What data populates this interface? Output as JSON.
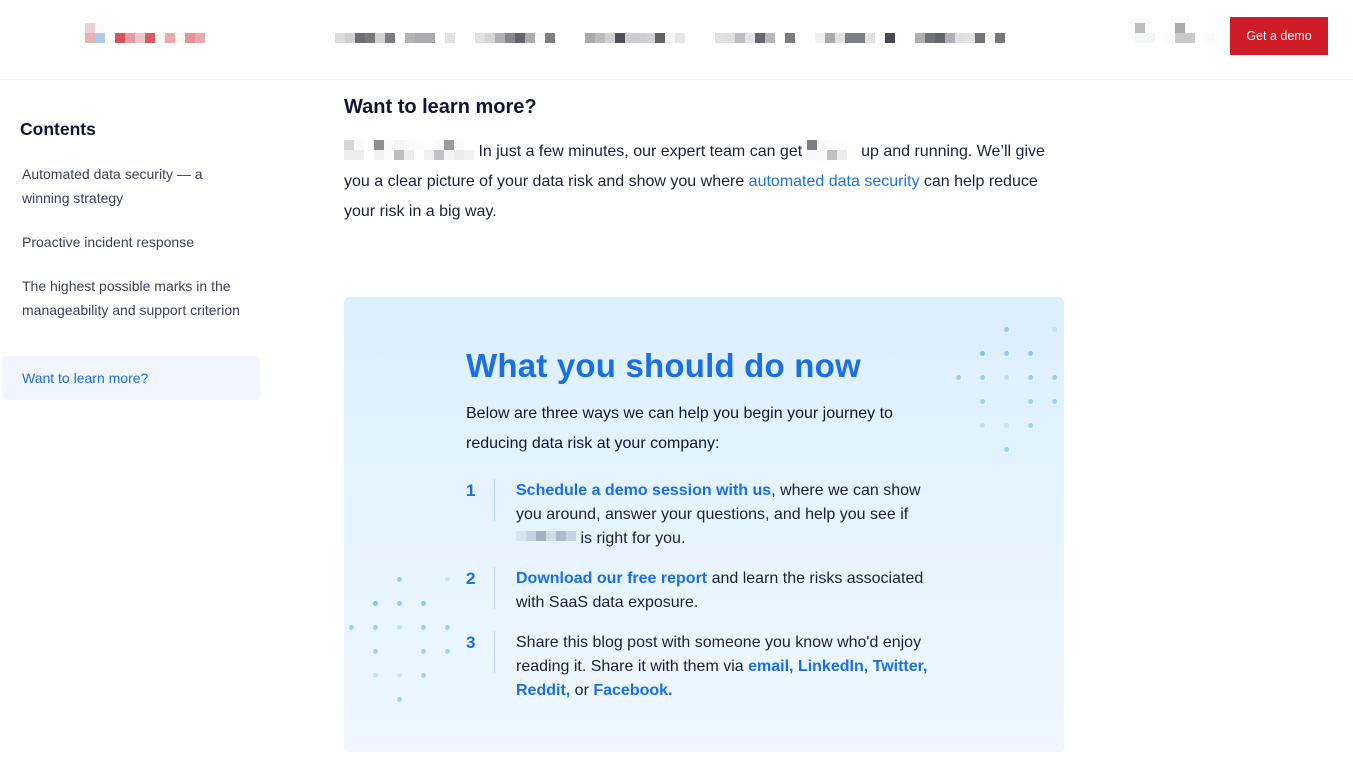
{
  "header": {
    "logo": "redacted-logo",
    "nav_items": [
      "redacted-nav-1",
      "redacted-nav-2",
      "redacted-nav-3",
      "redacted-nav-4",
      "redacted-nav-5",
      "redacted-nav-6"
    ],
    "login": "redacted-login",
    "cta_label": "Get a demo",
    "cta_color": "#d01c27"
  },
  "sidebar": {
    "title": "Contents",
    "items": [
      {
        "label": "Automated data security — a winning strategy",
        "active": false
      },
      {
        "label": "Proactive incident response",
        "active": false
      },
      {
        "label": "The highest possible marks in the manageability and support criterion",
        "active": false
      },
      {
        "label": "Want to learn more?",
        "active": true
      }
    ]
  },
  "main": {
    "title": "Want to learn more?",
    "intro": {
      "part1": "In just a few minutes, our expert team can get",
      "part2": "up and running.",
      "part3": "We’ll give you a clear picture of your data risk and show you where",
      "link": "automated data security",
      "part4": "can help reduce your risk in a big way."
    }
  },
  "card": {
    "title": "What you should do now",
    "subtitle": "Below are three ways we can help you begin your journey to reducing data risk at your company:",
    "steps": [
      {
        "num": "1",
        "link": "Schedule a demo session with us",
        "text_a": ", where we can show you around, answer your questions, and help you see if",
        "text_b": "is right for you."
      },
      {
        "num": "2",
        "link": "Download our free report",
        "text_a": "and learn the risks associated with SaaS data exposure."
      },
      {
        "num": "3",
        "text_a": "Share this blog post with someone you know who'd enjoy reading it. Share it with them via",
        "link_email": "email,",
        "link_linkedin": "LinkedIn,",
        "link_twitter": "Twitter,",
        "link_reddit": "Reddit,",
        "text_or": "or",
        "link_facebook": "Facebook."
      }
    ]
  },
  "colors": {
    "accent": "#1a6ee6",
    "link": "#1a73e8",
    "heading": "#101436",
    "card_bg": "#e2f2ff",
    "active_toc_bg": "#f1f5fd"
  }
}
